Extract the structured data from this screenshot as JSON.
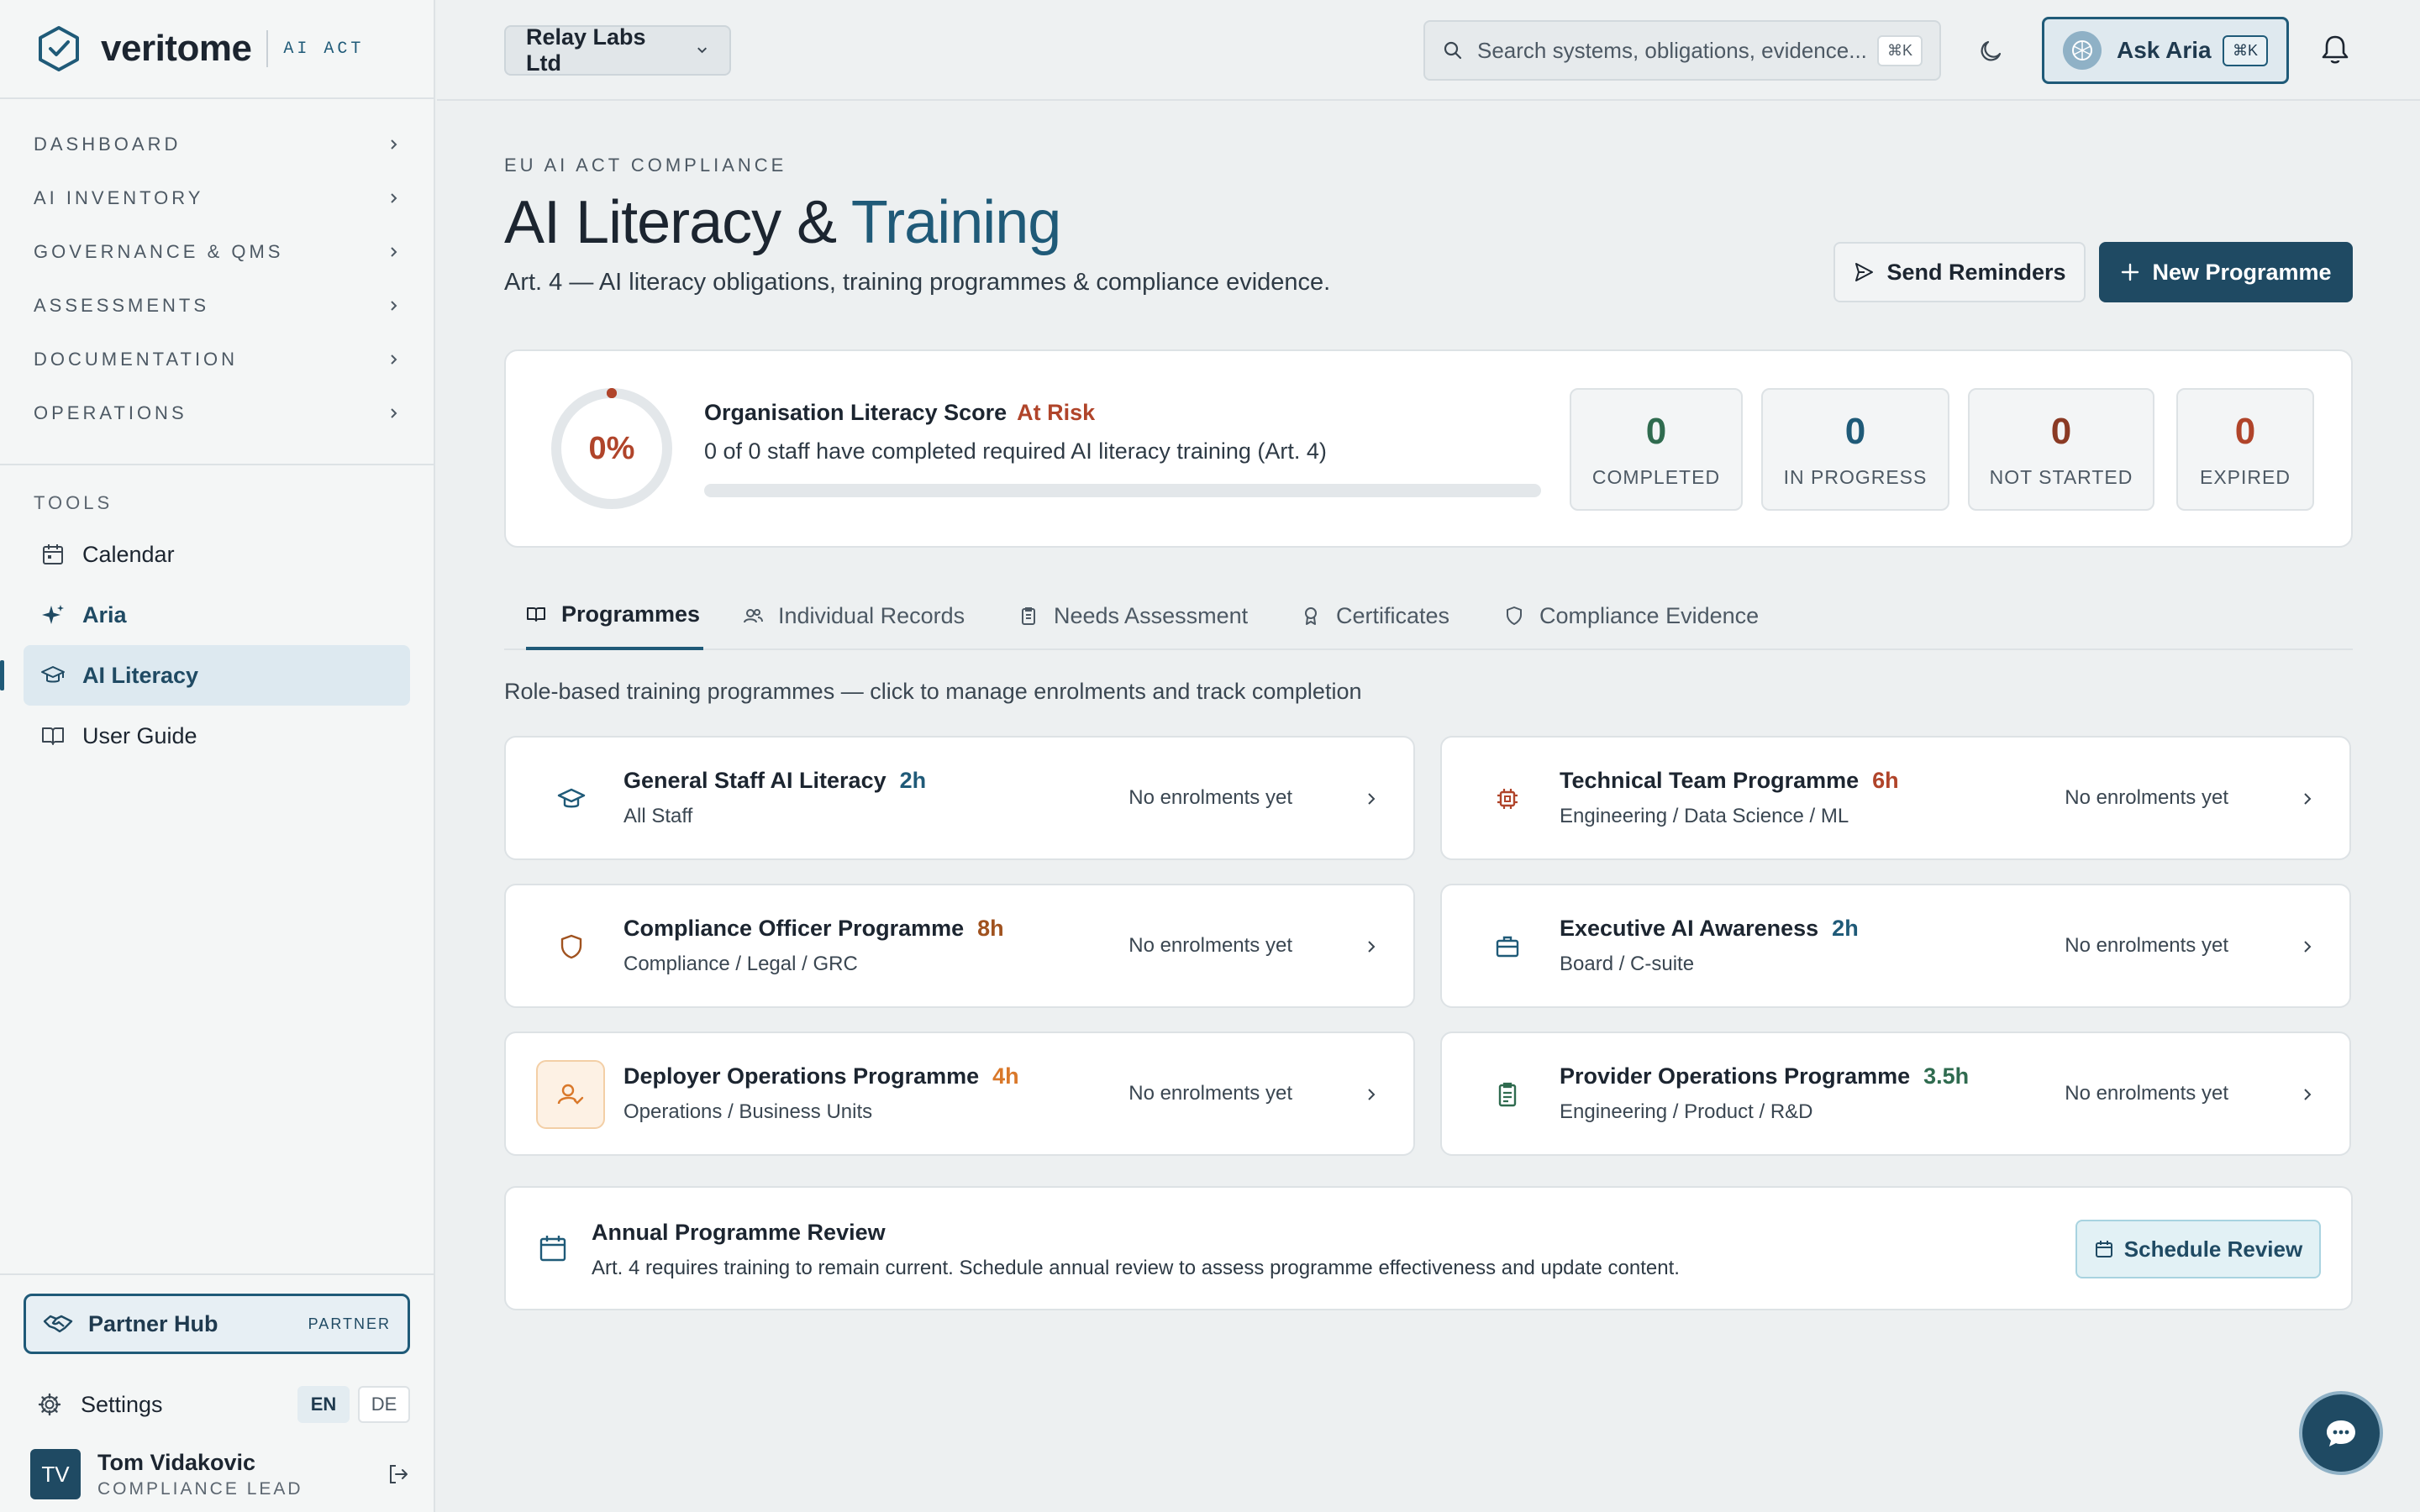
{
  "brand": {
    "name": "veritome",
    "tag": "AI ACT"
  },
  "colors": {
    "accent": "#1f5a78",
    "primary": "#1f4a63",
    "risk": "#b0442a",
    "orange": "#d9782a",
    "green": "#2f6b4f"
  },
  "sidebar": {
    "nav": [
      {
        "label": "DASHBOARD"
      },
      {
        "label": "AI INVENTORY"
      },
      {
        "label": "GOVERNANCE & QMS"
      },
      {
        "label": "ASSESSMENTS"
      },
      {
        "label": "DOCUMENTATION"
      },
      {
        "label": "OPERATIONS"
      }
    ],
    "tools_title": "TOOLS",
    "tools": [
      {
        "label": "Calendar",
        "icon": "calendar-icon"
      },
      {
        "label": "Aria",
        "icon": "sparkle-icon"
      },
      {
        "label": "AI Literacy",
        "icon": "graduation-cap-icon",
        "active": true
      },
      {
        "label": "User Guide",
        "icon": "book-icon"
      }
    ],
    "partner": {
      "label": "Partner Hub",
      "badge": "PARTNER"
    },
    "settings_label": "Settings",
    "languages": [
      "EN",
      "DE"
    ],
    "active_language": "EN",
    "user": {
      "initials": "TV",
      "name": "Tom Vidakovic",
      "role": "COMPLIANCE LEAD"
    }
  },
  "topbar": {
    "org": "Relay Labs Ltd",
    "search_placeholder": "Search systems, obligations, evidence...",
    "search_kbd": "⌘K",
    "ask_label": "Ask Aria",
    "ask_kbd": "⌘K"
  },
  "page": {
    "eyebrow": "EU AI ACT COMPLIANCE",
    "title_main": "AI Literacy & ",
    "title_accent": "Training",
    "subtitle": "Art. 4 — AI literacy obligations, training programmes & compliance evidence.",
    "send_reminders": "Send Reminders",
    "new_programme": "New Programme"
  },
  "score": {
    "value": "0%",
    "progress": 0,
    "title": "Organisation Literacy Score",
    "status": "At Risk",
    "description": "0 of 0 staff have completed required AI literacy training (Art. 4)",
    "stats": [
      {
        "value": "0",
        "label": "COMPLETED",
        "color": "#2f6b4f"
      },
      {
        "value": "0",
        "label": "IN PROGRESS",
        "color": "#1f5a78"
      },
      {
        "value": "0",
        "label": "NOT STARTED",
        "color": "#8a3a24"
      },
      {
        "value": "0",
        "label": "EXPIRED",
        "color": "#b0442a"
      }
    ]
  },
  "tabs": [
    {
      "label": "Programmes",
      "icon": "book-icon",
      "active": true
    },
    {
      "label": "Individual Records",
      "icon": "users-icon"
    },
    {
      "label": "Needs Assessment",
      "icon": "clipboard-icon"
    },
    {
      "label": "Certificates",
      "icon": "award-icon"
    },
    {
      "label": "Compliance Evidence",
      "icon": "shield-icon"
    }
  ],
  "tab_caption": "Role-based training programmes — click to manage enrolments and track completion",
  "programmes": [
    {
      "title": "General Staff AI Literacy",
      "hours": "2h",
      "hours_color": "#1f5a78",
      "audience": "All Staff",
      "status": "No enrolments yet",
      "icon": "graduation-cap-icon"
    },
    {
      "title": "Technical Team Programme",
      "hours": "6h",
      "hours_color": "#b0442a",
      "audience": "Engineering / Data Science / ML",
      "status": "No enrolments yet",
      "icon": "chip-icon"
    },
    {
      "title": "Compliance Officer Programme",
      "hours": "8h",
      "hours_color": "#a0521f",
      "audience": "Compliance / Legal / GRC",
      "status": "No enrolments yet",
      "icon": "shield-icon"
    },
    {
      "title": "Executive AI Awareness",
      "hours": "2h",
      "hours_color": "#1f5a78",
      "audience": "Board / C-suite",
      "status": "No enrolments yet",
      "icon": "briefcase-icon"
    },
    {
      "title": "Deployer Operations Programme",
      "hours": "4h",
      "hours_color": "#d9782a",
      "audience": "Operations / Business Units",
      "status": "No enrolments yet",
      "icon": "user-check-icon"
    },
    {
      "title": "Provider Operations Programme",
      "hours": "3.5h",
      "hours_color": "#2f6b4f",
      "audience": "Engineering / Product / R&D",
      "status": "No enrolments yet",
      "icon": "clipboard-icon"
    }
  ],
  "review": {
    "title": "Annual Programme Review",
    "description": "Art. 4 requires training to remain current. Schedule annual review to assess programme effectiveness and update content.",
    "button": "Schedule Review"
  }
}
